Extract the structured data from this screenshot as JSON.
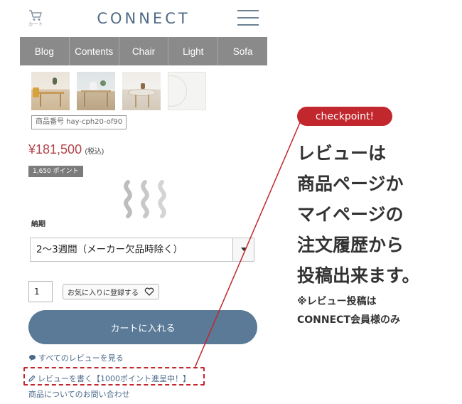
{
  "header": {
    "cart_label": "カート",
    "brand": "CONNECT"
  },
  "nav": {
    "items": [
      "Blog",
      "Contents",
      "Chair",
      "Light",
      "Sofa"
    ]
  },
  "product": {
    "sku": "商品番号 hay-cph20-of90",
    "price": "¥181,500",
    "tax_note": "(税込)",
    "points": "1,650 ポイント"
  },
  "delivery": {
    "label": "納期",
    "selected": "2〜3週間（メーカー欠品時除く）"
  },
  "purchase": {
    "quantity": "1",
    "favorite_label": "お気に入りに登録する",
    "add_to_cart": "カートに入れる"
  },
  "links": {
    "all_reviews": "すべてのレビューを見る",
    "write_review": "レビューを書く【1000ポイント進呈中！】",
    "inquiry": "商品についてのお問い合わせ"
  },
  "annotation": {
    "badge": "checkpoint!",
    "lines": [
      "レビューは",
      "商品ページか",
      "マイページの",
      "注文履歴から",
      "投稿出来ます。"
    ],
    "note_lines": [
      "※レビュー投稿は",
      "CONNECT会員様のみ"
    ],
    "accent_color": "#c1272d"
  },
  "colors": {
    "nav_bg": "#8a8a8a",
    "button_bg": "#5a7a98",
    "price": "#b3424a",
    "link": "#4c6a8a"
  },
  "icons": [
    "cart-icon",
    "hamburger-menu-icon",
    "heart-icon",
    "chat-bubble-icon",
    "pencil-icon",
    "loading-swirl-icon",
    "select-arrow-icon"
  ]
}
